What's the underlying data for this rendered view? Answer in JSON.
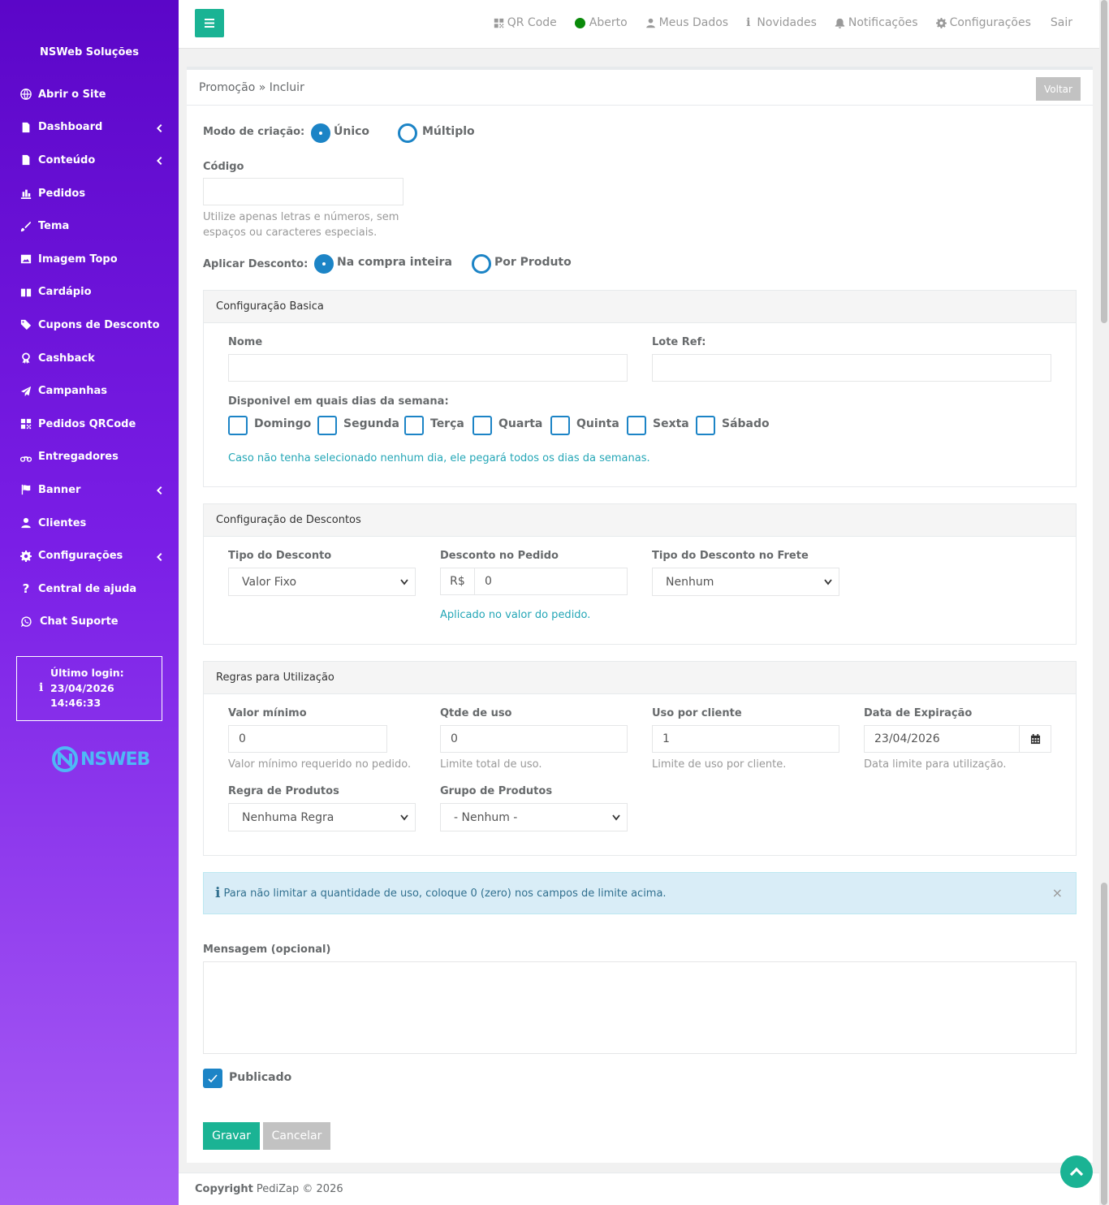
{
  "sidebar": {
    "brand": "NSWeb Soluções",
    "items": [
      {
        "label": "Abrir o Site"
      },
      {
        "label": "Dashboard"
      },
      {
        "label": "Conteúdo"
      },
      {
        "label": "Pedidos"
      },
      {
        "label": "Tema"
      },
      {
        "label": "Imagem Topo"
      },
      {
        "label": "Cardápio"
      },
      {
        "label": "Cupons de Desconto"
      },
      {
        "label": "Cashback"
      },
      {
        "label": "Campanhas"
      },
      {
        "label": "Pedidos QRCode"
      },
      {
        "label": "Entregadores"
      },
      {
        "label": "Banner"
      },
      {
        "label": "Clientes"
      },
      {
        "label": "Configurações"
      },
      {
        "label": "Central de ajuda"
      },
      {
        "label": "Chat Suporte"
      }
    ],
    "login_title": "Último login:",
    "login_date": "23/04/2026",
    "login_time": "14:46:33",
    "logo_text": "NSWEB"
  },
  "topbar": {
    "qr": "QR Code",
    "status": "Aberto",
    "meus_dados": "Meus Dados",
    "novidades": "Novidades",
    "notificacoes": "Notificações",
    "configuracoes": "Configurações",
    "sair": "Sair"
  },
  "page": {
    "breadcrumb": "Promoção » Incluir",
    "voltar": "Voltar"
  },
  "form": {
    "modo_label": "Modo de criação:",
    "modo_unico": "Único",
    "modo_multiplo": "Múltiplo",
    "codigo_label": "Código",
    "codigo_help": "Utilize apenas letras e números, sem espaços ou caracteres especiais.",
    "aplicar_label": "Aplicar Desconto:",
    "aplicar_inteira": "Na compra inteira",
    "aplicar_produto": "Por Produto"
  },
  "basica": {
    "title": "Configuração Basica",
    "nome_label": "Nome",
    "lote_label": "Lote Ref:",
    "dias_label": "Disponivel em quais dias da semana:",
    "dias": [
      "Domingo",
      "Segunda",
      "Terça",
      "Quarta",
      "Quinta",
      "Sexta",
      "Sábado"
    ],
    "dias_help": "Caso não tenha selecionado nenhum dia, ele pegará todos os dias da semanas."
  },
  "descontos": {
    "title": "Configuração de Descontos",
    "tipo_label": "Tipo do Desconto",
    "tipo_value": "Valor Fixo",
    "pedido_label": "Desconto no Pedido",
    "pedido_prefix": "R$",
    "pedido_value": "0",
    "pedido_help": "Aplicado no valor do pedido.",
    "frete_label": "Tipo do Desconto no Frete",
    "frete_value": "Nenhum"
  },
  "regras": {
    "title": "Regras para Utilização",
    "minimo_label": "Valor mínimo",
    "minimo_value": "0",
    "minimo_help": "Valor mínimo requerido no pedido.",
    "qtde_label": "Qtde de uso",
    "qtde_value": "0",
    "qtde_help": "Limite total de uso.",
    "uso_label": "Uso por cliente",
    "uso_value": "1",
    "uso_help": "Limite de uso por cliente.",
    "data_label": "Data de Expiração",
    "data_value": "23/04/2026",
    "data_help": "Data limite para utilização.",
    "regra_label": "Regra de Produtos",
    "regra_value": "Nenhuma Regra",
    "grupo_label": "Grupo de Produtos",
    "grupo_value": "- Nenhum -"
  },
  "alert": {
    "text": "Para não limitar a quantidade de uso, coloque 0 (zero) nos campos de limite acima.",
    "close": "×"
  },
  "mensagem_label": "Mensagem (opcional)",
  "publicado_label": "Publicado",
  "publicado_checked": true,
  "buttons": {
    "gravar": "Gravar",
    "cancelar": "Cancelar"
  },
  "footer": {
    "copyright": "Copyright",
    "rest": "PediZap © 2026"
  },
  "colors": {
    "sidebar_top": "#5b06c8",
    "sidebar_bottom": "#a75cf5",
    "primary": "#1ab394",
    "blue": "#1c84c6"
  }
}
